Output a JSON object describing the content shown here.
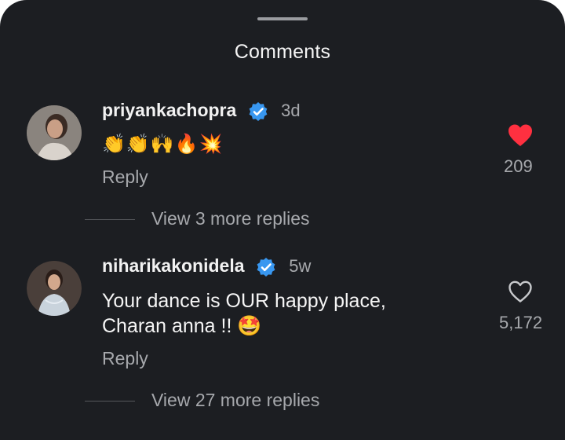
{
  "sheet": {
    "title": "Comments"
  },
  "comments": [
    {
      "username": "priyankachopra",
      "time": "3d",
      "text": "👏👏🙌🔥💥",
      "reply_label": "Reply",
      "likes": "209",
      "liked": true,
      "view_more": "View 3 more replies"
    },
    {
      "username": "niharikakonidela",
      "time": "5w",
      "text_line1": "Your dance is OUR happy place,",
      "text_line2": "Charan anna !! 🤩",
      "reply_label": "Reply",
      "likes": "5,172",
      "liked": false,
      "view_more": "View 27 more replies"
    }
  ],
  "colors": {
    "background": "#1c1e22",
    "verified": "#3897f0",
    "like_active": "#ff3040",
    "muted_text": "#a7a9ad"
  }
}
